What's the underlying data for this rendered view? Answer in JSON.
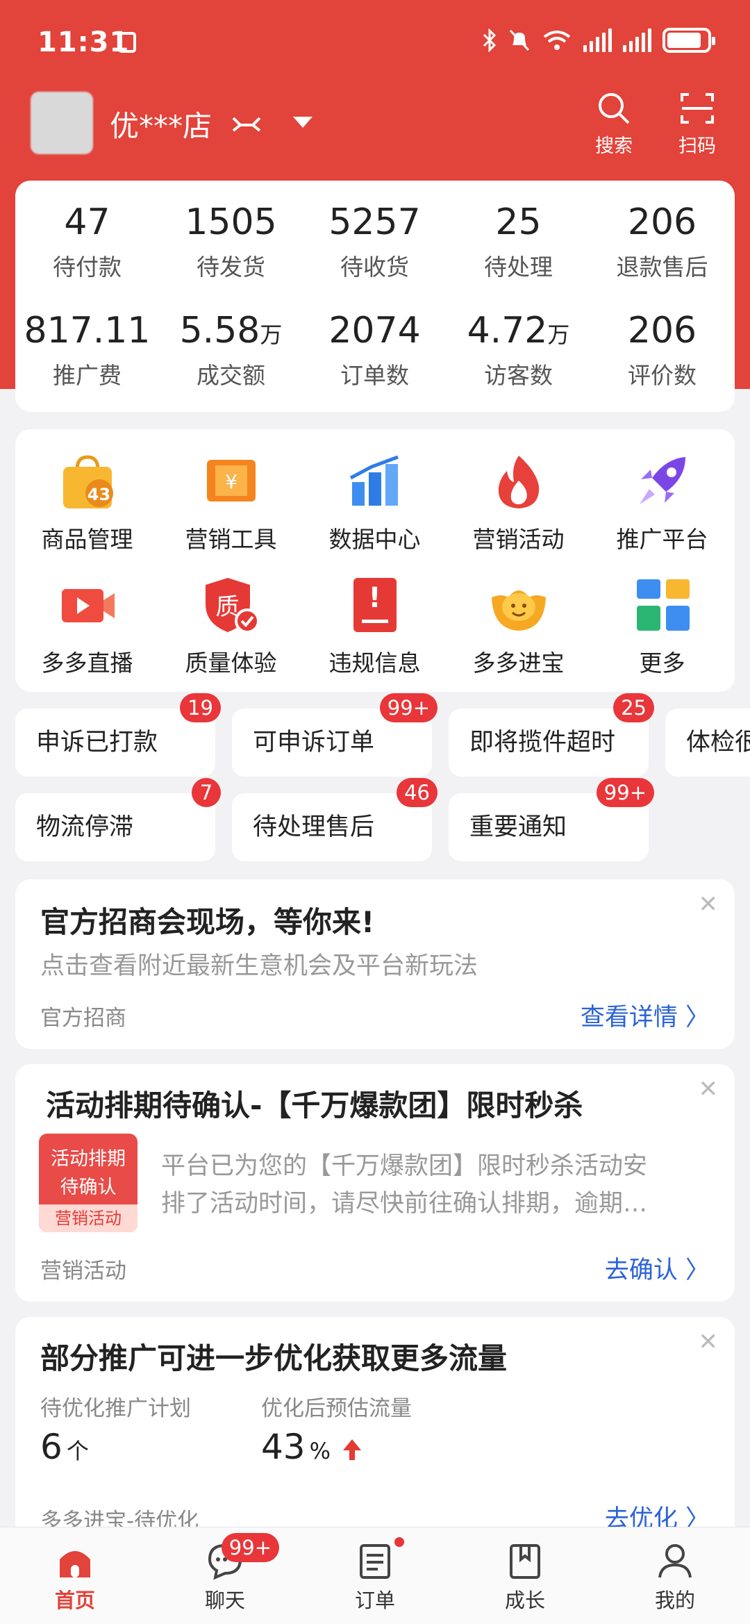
{
  "status": {
    "time": "11:31"
  },
  "shop": {
    "name": "优***店",
    "search_label": "搜索",
    "scan_label": "扫码"
  },
  "stats": [
    {
      "value": "47",
      "unit": "",
      "label": "待付款"
    },
    {
      "value": "1505",
      "unit": "",
      "label": "待发货"
    },
    {
      "value": "5257",
      "unit": "",
      "label": "待收货"
    },
    {
      "value": "25",
      "unit": "",
      "label": "待处理"
    },
    {
      "value": "206",
      "unit": "",
      "label": "退款售后"
    },
    {
      "value": "817.11",
      "unit": "",
      "label": "推广费"
    },
    {
      "value": "5.58",
      "unit": "万",
      "label": "成交额"
    },
    {
      "value": "2074",
      "unit": "",
      "label": "订单数"
    },
    {
      "value": "4.72",
      "unit": "万",
      "label": "访客数"
    },
    {
      "value": "206",
      "unit": "",
      "label": "评价数"
    }
  ],
  "tools": [
    {
      "label": "商品管理",
      "icon": "shopping-bag-icon",
      "badge": "43"
    },
    {
      "label": "营销工具",
      "icon": "coupon-icon"
    },
    {
      "label": "数据中心",
      "icon": "bar-chart-icon"
    },
    {
      "label": "营销活动",
      "icon": "flame-icon"
    },
    {
      "label": "推广平台",
      "icon": "rocket-icon"
    },
    {
      "label": "多多直播",
      "icon": "live-video-icon"
    },
    {
      "label": "质量体验",
      "icon": "quality-shield-icon",
      "glyph": "质"
    },
    {
      "label": "违规信息",
      "icon": "violation-alert-icon",
      "glyph": "!"
    },
    {
      "label": "多多进宝",
      "icon": "ingot-icon"
    },
    {
      "label": "更多",
      "icon": "more-apps-icon"
    }
  ],
  "chips": [
    {
      "label": "申诉已打款",
      "badge": "19"
    },
    {
      "label": "可申诉订单",
      "badge": "99+"
    },
    {
      "label": "即将揽件超时",
      "badge": "25"
    },
    {
      "label": "体检很",
      "badge": ""
    },
    {
      "label": "物流停滞",
      "badge": "7"
    },
    {
      "label": "待处理售后",
      "badge": "46"
    },
    {
      "label": "重要通知",
      "badge": "99+"
    }
  ],
  "notice1": {
    "title": "官方招商会现场，等你来!",
    "desc": "点击查看附近最新生意机会及平台新玩法",
    "source": "官方招商",
    "link": "查看详情 〉"
  },
  "notice2": {
    "title": "活动排期待确认-【千万爆款团】限时秒杀",
    "thumb_line1": "活动排期",
    "thumb_line2": "待确认",
    "thumb_tag": "营销活动",
    "desc1": "平台已为您的【千万爆款团】限时秒杀活动安",
    "desc2": "排了活动时间，请尽快前往确认排期，逾期…",
    "source": "营销活动",
    "link": "去确认 〉"
  },
  "notice3": {
    "title": "部分推广可进一步优化获取更多流量",
    "label1": "待优化推广计划",
    "value1": "6",
    "unit1": "个",
    "label2": "优化后预估流量",
    "value2": "43",
    "unit2": "%",
    "source": "多多进宝-待优化",
    "link": "去优化 〉"
  },
  "tabbar": [
    {
      "label": "首页",
      "icon": "home-icon",
      "active": true
    },
    {
      "label": "聊天",
      "icon": "chat-icon",
      "badge": "99+"
    },
    {
      "label": "订单",
      "icon": "order-icon",
      "dot": true
    },
    {
      "label": "成长",
      "icon": "growth-book-icon"
    },
    {
      "label": "我的",
      "icon": "profile-icon"
    }
  ],
  "colors": {
    "brand": "#e2433a",
    "link": "#2b63d6",
    "badge": "#e8363a"
  }
}
